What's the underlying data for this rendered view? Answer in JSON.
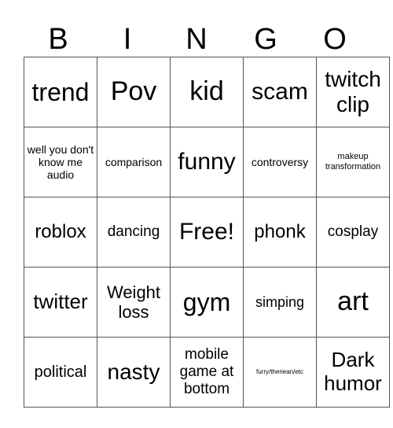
{
  "header": [
    "B",
    "I",
    "N",
    "G",
    "O"
  ],
  "cells": [
    [
      {
        "t": "trend",
        "s": 32
      },
      {
        "t": "Pov",
        "s": 34
      },
      {
        "t": "kid",
        "s": 34
      },
      {
        "t": "scam",
        "s": 30
      },
      {
        "t": "twitch clip",
        "s": 28
      }
    ],
    [
      {
        "t": "well you don't know me audio",
        "s": 14
      },
      {
        "t": "comparison",
        "s": 14
      },
      {
        "t": "funny",
        "s": 30
      },
      {
        "t": "controversy",
        "s": 14
      },
      {
        "t": "makeup transformation",
        "s": 11
      }
    ],
    [
      {
        "t": "roblox",
        "s": 24
      },
      {
        "t": "dancing",
        "s": 19
      },
      {
        "t": "Free!",
        "s": 30
      },
      {
        "t": "phonk",
        "s": 24
      },
      {
        "t": "cosplay",
        "s": 19
      }
    ],
    [
      {
        "t": "twitter",
        "s": 26
      },
      {
        "t": "Weight loss",
        "s": 22
      },
      {
        "t": "gym",
        "s": 32
      },
      {
        "t": "simping",
        "s": 18
      },
      {
        "t": "art",
        "s": 34
      }
    ],
    [
      {
        "t": "political",
        "s": 20
      },
      {
        "t": "nasty",
        "s": 28
      },
      {
        "t": "mobile game at bottom",
        "s": 19
      },
      {
        "t": "furry/theriean/etc",
        "s": 8
      },
      {
        "t": "Dark humor",
        "s": 26
      }
    ]
  ]
}
